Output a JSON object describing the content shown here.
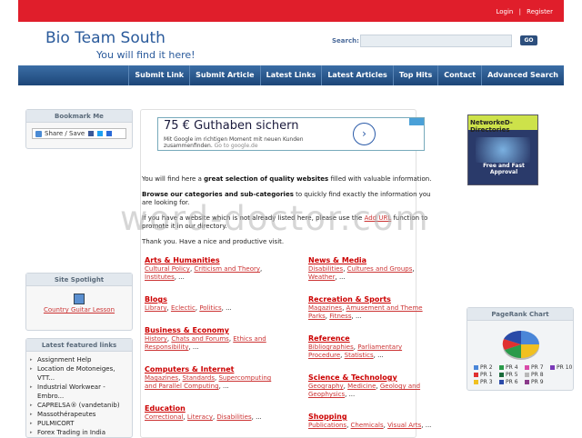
{
  "top": {
    "login": "Login",
    "separator": "|",
    "register": "Register"
  },
  "header": {
    "title": "Bio Team South",
    "tagline": "You will find it here!"
  },
  "search": {
    "label": "Search:",
    "value": "",
    "go_label": "GO"
  },
  "nav": [
    "Submit Link",
    "Submit Article",
    "Latest Links",
    "Latest Articles",
    "Top Hits",
    "Contact",
    "Advanced Search"
  ],
  "bookmark": {
    "title": "Bookmark Me",
    "share_label": "Share / Save"
  },
  "spotlight": {
    "title": "Site Spotlight",
    "link": "Country Guitar Lesson"
  },
  "featured": {
    "title": "Latest featured links",
    "items": [
      "Assignment Help",
      "Location de Motoneiges, VTT...",
      "Industrial Workwear - Embro...",
      "CAPRELSA® (vandetanib)",
      "Massothérapeutes",
      "PULMICORT",
      "Forex Trading in India"
    ]
  },
  "ad": {
    "headline": "75 € Guthaben sichern",
    "body": "Mit Google im richtigen Moment mit neuen Kunden zusammenfinden.",
    "domain": "Go to google.de"
  },
  "intro": {
    "p1_a": "You will find here a ",
    "p1_bold": "great selection of quality websites",
    "p1_b": " filled with valuable information.",
    "p2_bold": "Browse our categories and sub-categories",
    "p2_rest": " to quickly find exactly the information you are looking for.",
    "p3": "If you have a website which is not already listed here, please use the",
    "p3_link": "Add URL",
    "p3_tail": "function to promote it in our directory.",
    "p4": "Thank you. Have a nice and productive visit."
  },
  "categories": [
    {
      "title": "Arts & Humanities",
      "subs": [
        "Cultural Policy",
        "Criticism and Theory",
        "Institutes"
      ],
      "more": "..."
    },
    {
      "title": "News & Media",
      "subs": [
        "Disabilities",
        "Cultures and Groups",
        "Weather"
      ],
      "more": "..."
    },
    {
      "title": "Blogs",
      "subs": [
        "Library",
        "Eclectic",
        "Politics"
      ],
      "more": "..."
    },
    {
      "title": "Recreation & Sports",
      "subs": [
        "Magazines",
        "Amusement and Theme Parks",
        "Fitness"
      ],
      "more": "..."
    },
    {
      "title": "Business & Economy",
      "subs": [
        "History",
        "Chats and Forums",
        "Ethics and Responsibility"
      ],
      "more": "..."
    },
    {
      "title": "Reference",
      "subs": [
        "Bibliographies",
        "Parliamentary Procedure",
        "Statistics"
      ],
      "more": "..."
    },
    {
      "title": "Computers & Internet",
      "subs": [
        "Magazines",
        "Standards",
        "Supercomputing and Parallel Computing"
      ],
      "more": "..."
    },
    {
      "title": "Science & Technology",
      "subs": [
        "Geography",
        "Medicine",
        "Geology and Geophysics"
      ],
      "more": "..."
    },
    {
      "title": "Education",
      "subs": [
        "Correctional",
        "Literacy",
        "Disabilities"
      ],
      "more": "..."
    },
    {
      "title": "Shopping",
      "subs": [
        "Publications",
        "Chemicals",
        "Visual Arts"
      ],
      "more": "..."
    }
  ],
  "netbanner": {
    "title": "NetworkeD-Directories",
    "footer": "Free and Fast Approval"
  },
  "pagerank": {
    "title": "PageRank Chart",
    "legend": [
      {
        "label": "PR 2",
        "color": "#4a86d8"
      },
      {
        "label": "PR 4",
        "color": "#2a9a4a"
      },
      {
        "label": "PR 7",
        "color": "#d84aa8"
      },
      {
        "label": "PR 10",
        "color": "#7a3ab8"
      },
      {
        "label": "PR 1",
        "color": "#e03030"
      },
      {
        "label": "PR 5",
        "color": "#1a6a3a"
      },
      {
        "label": "PR 8",
        "color": "#b8b8b8"
      },
      {
        "label": "PR 3",
        "color": "#f0c020"
      },
      {
        "label": "PR 6",
        "color": "#2a4aa8"
      },
      {
        "label": "PR 9",
        "color": "#8a3a8a"
      }
    ]
  },
  "watermark": "word-doctor.com"
}
